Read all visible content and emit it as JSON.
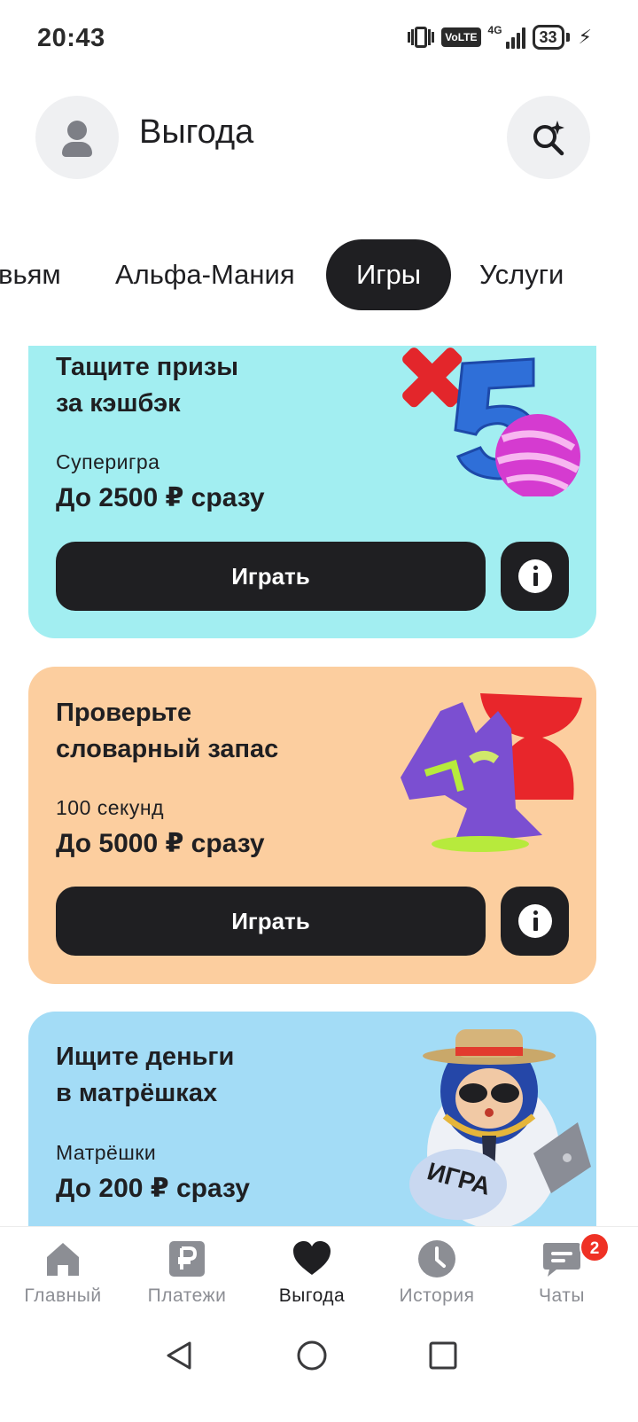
{
  "status_bar": {
    "time": "20:43",
    "network_label": "VoLTE",
    "network_type": "4G",
    "battery": "33"
  },
  "header": {
    "title": "Выгода"
  },
  "tabs": [
    {
      "label": "вьям",
      "active": false
    },
    {
      "label": "Альфа-Мания",
      "active": false
    },
    {
      "label": "Игры",
      "active": true
    },
    {
      "label": "Услуги",
      "active": false
    }
  ],
  "cards": [
    {
      "title_line1": "Тащите призы",
      "title_line2": "за кэшбэк",
      "subtitle": "Суперигра",
      "amount": "До 2500 ₽ сразу",
      "button_label": "Играть",
      "background": "#a2eef1"
    },
    {
      "title_line1": "Проверьте",
      "title_line2": "словарный запас",
      "subtitle": "100 секунд",
      "amount": "До 5000 ₽ сразу",
      "button_label": "Играть",
      "background": "#fcce9f"
    },
    {
      "title_line1": "Ищите деньги",
      "title_line2": "в матрёшках",
      "subtitle": "Матрёшки",
      "amount": "До 200 ₽ сразу",
      "art_text": "ИГРА",
      "background": "#a3dcf6"
    }
  ],
  "bottom_nav": {
    "items": [
      {
        "label": "Главный",
        "icon": "home-icon",
        "active": false
      },
      {
        "label": "Платежи",
        "icon": "ruble-icon",
        "active": false
      },
      {
        "label": "Выгода",
        "icon": "heart-icon",
        "active": true
      },
      {
        "label": "История",
        "icon": "clock-icon",
        "active": false
      },
      {
        "label": "Чаты",
        "icon": "chat-icon",
        "active": false,
        "badge": "2"
      }
    ]
  },
  "colors": {
    "accent_dark": "#1f1f22",
    "badge_red": "#ef3124",
    "inactive_gray": "#8c8e94"
  }
}
